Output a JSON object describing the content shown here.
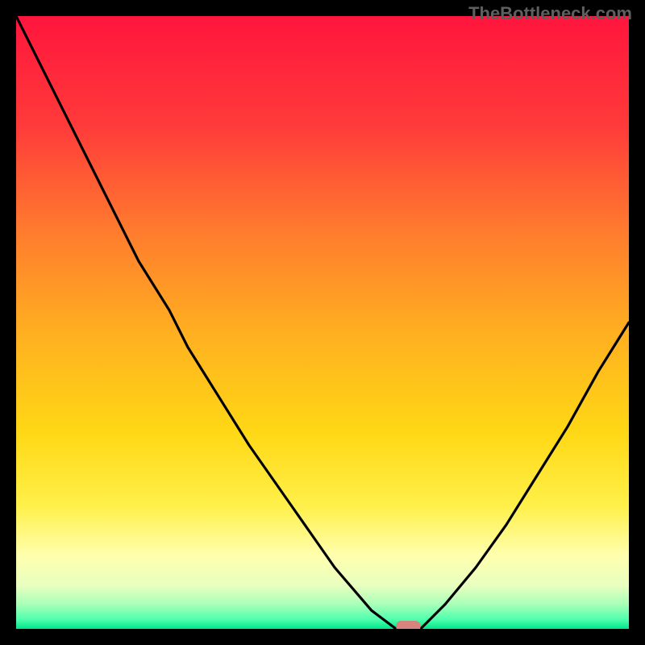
{
  "watermark": "TheBottleneck.com",
  "chart_data": {
    "type": "line",
    "title": "",
    "xlabel": "",
    "ylabel": "",
    "x": [
      0,
      5,
      10,
      15,
      20,
      25,
      28,
      33,
      38,
      45,
      52,
      58,
      62,
      64,
      66,
      70,
      75,
      80,
      85,
      90,
      95,
      100
    ],
    "values": [
      100,
      90,
      80,
      70,
      60,
      52,
      46,
      38,
      30,
      20,
      10,
      3,
      0,
      0,
      0,
      4,
      10,
      17,
      25,
      33,
      42,
      50
    ],
    "xlim": [
      0,
      100
    ],
    "ylim": [
      0,
      100
    ],
    "annotations": {
      "marker": {
        "x": 64,
        "y": 0,
        "color": "#d8847e"
      }
    },
    "background_gradient": {
      "top": "#ff1744",
      "upper_mid": "#ff9100",
      "mid": "#ffd600",
      "lower_mid": "#ffff8d",
      "bottom": "#00e676"
    }
  }
}
